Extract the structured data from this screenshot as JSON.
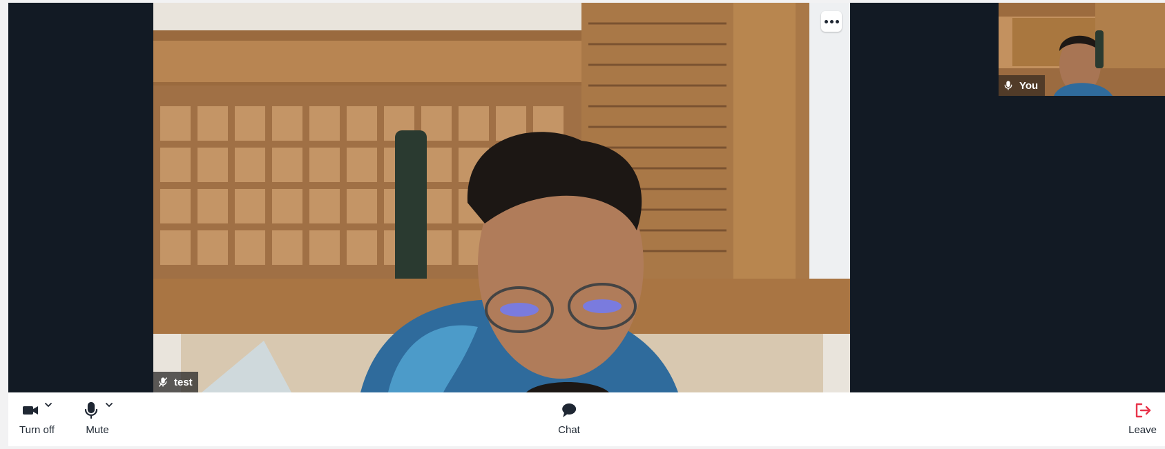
{
  "main_participant": {
    "name": "test",
    "mic_state": "muted",
    "more_menu_icon": "ellipsis-icon"
  },
  "self_view": {
    "name": "You",
    "mic_state": "on"
  },
  "controls": {
    "camera_label": "Turn off",
    "mic_label": "Mute",
    "chat_label": "Chat",
    "leave_label": "Leave"
  },
  "colors": {
    "stage_background": "#121a24",
    "leave_accent": "#e8334a",
    "icon_color": "#1f2733"
  }
}
